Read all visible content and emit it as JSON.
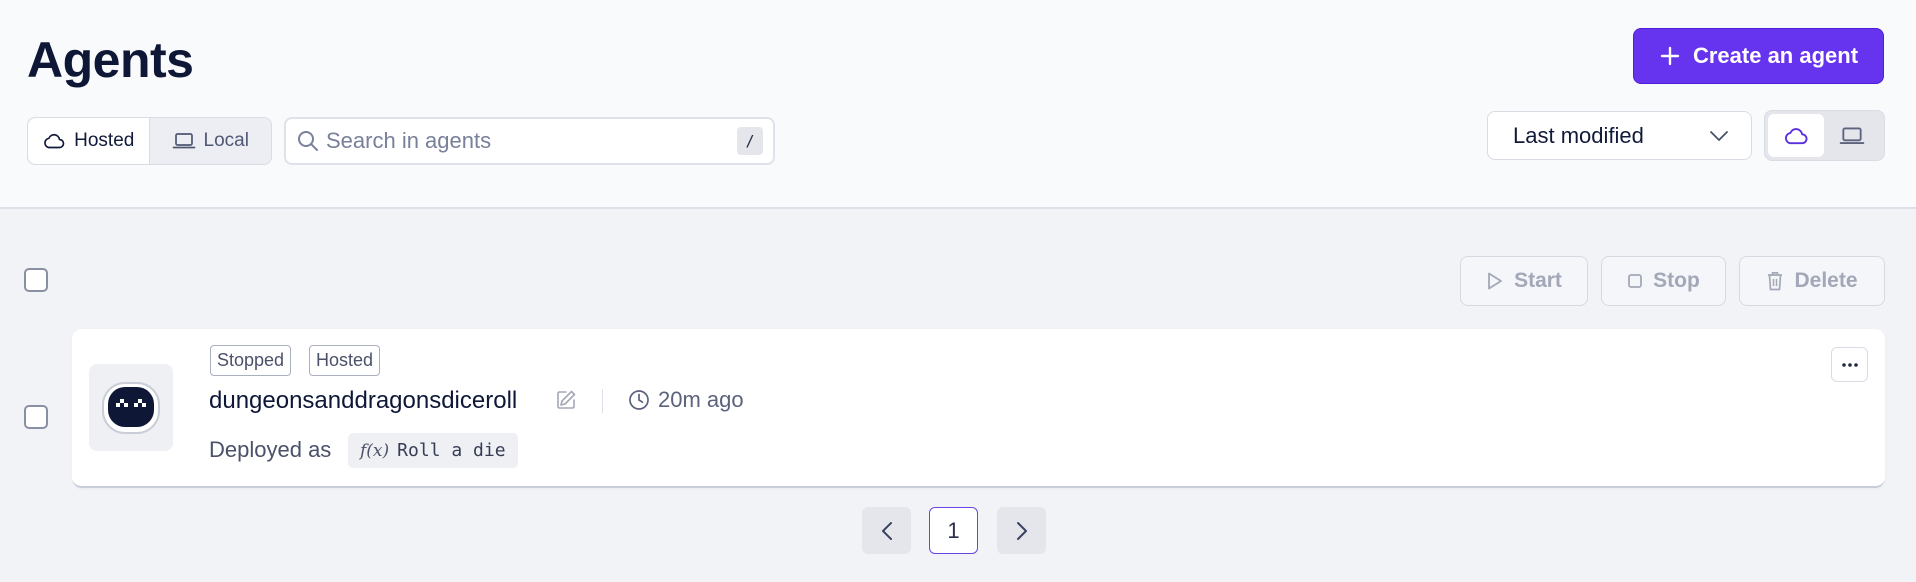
{
  "header": {
    "title": "Agents",
    "create_button": "Create an agent"
  },
  "filters": {
    "segments": [
      {
        "label": "Hosted",
        "icon": "cloud-icon",
        "active": true
      },
      {
        "label": "Local",
        "icon": "laptop-icon",
        "active": false
      }
    ],
    "search": {
      "placeholder": "Search in agents",
      "value": "",
      "shortcut": "/"
    },
    "sort": {
      "selected": "Last modified"
    },
    "view_toggle": [
      {
        "icon": "cloud-icon",
        "active": true
      },
      {
        "icon": "laptop-icon",
        "active": false
      }
    ]
  },
  "bulk_actions": {
    "start": "Start",
    "stop": "Stop",
    "delete": "Delete"
  },
  "agents": [
    {
      "name": "dungeonsanddragonsdiceroll",
      "badges": [
        "Stopped",
        "Hosted"
      ],
      "updated": "20m ago",
      "deployed_label": "Deployed as",
      "function_prefix": "f(x)",
      "function_name": "Roll a die"
    }
  ],
  "pagination": {
    "current_page": "1"
  },
  "colors": {
    "accent": "#6633ee",
    "header_bg": "#f9fafc",
    "page_bg": "#f2f3f7",
    "text": "#0f1737"
  }
}
